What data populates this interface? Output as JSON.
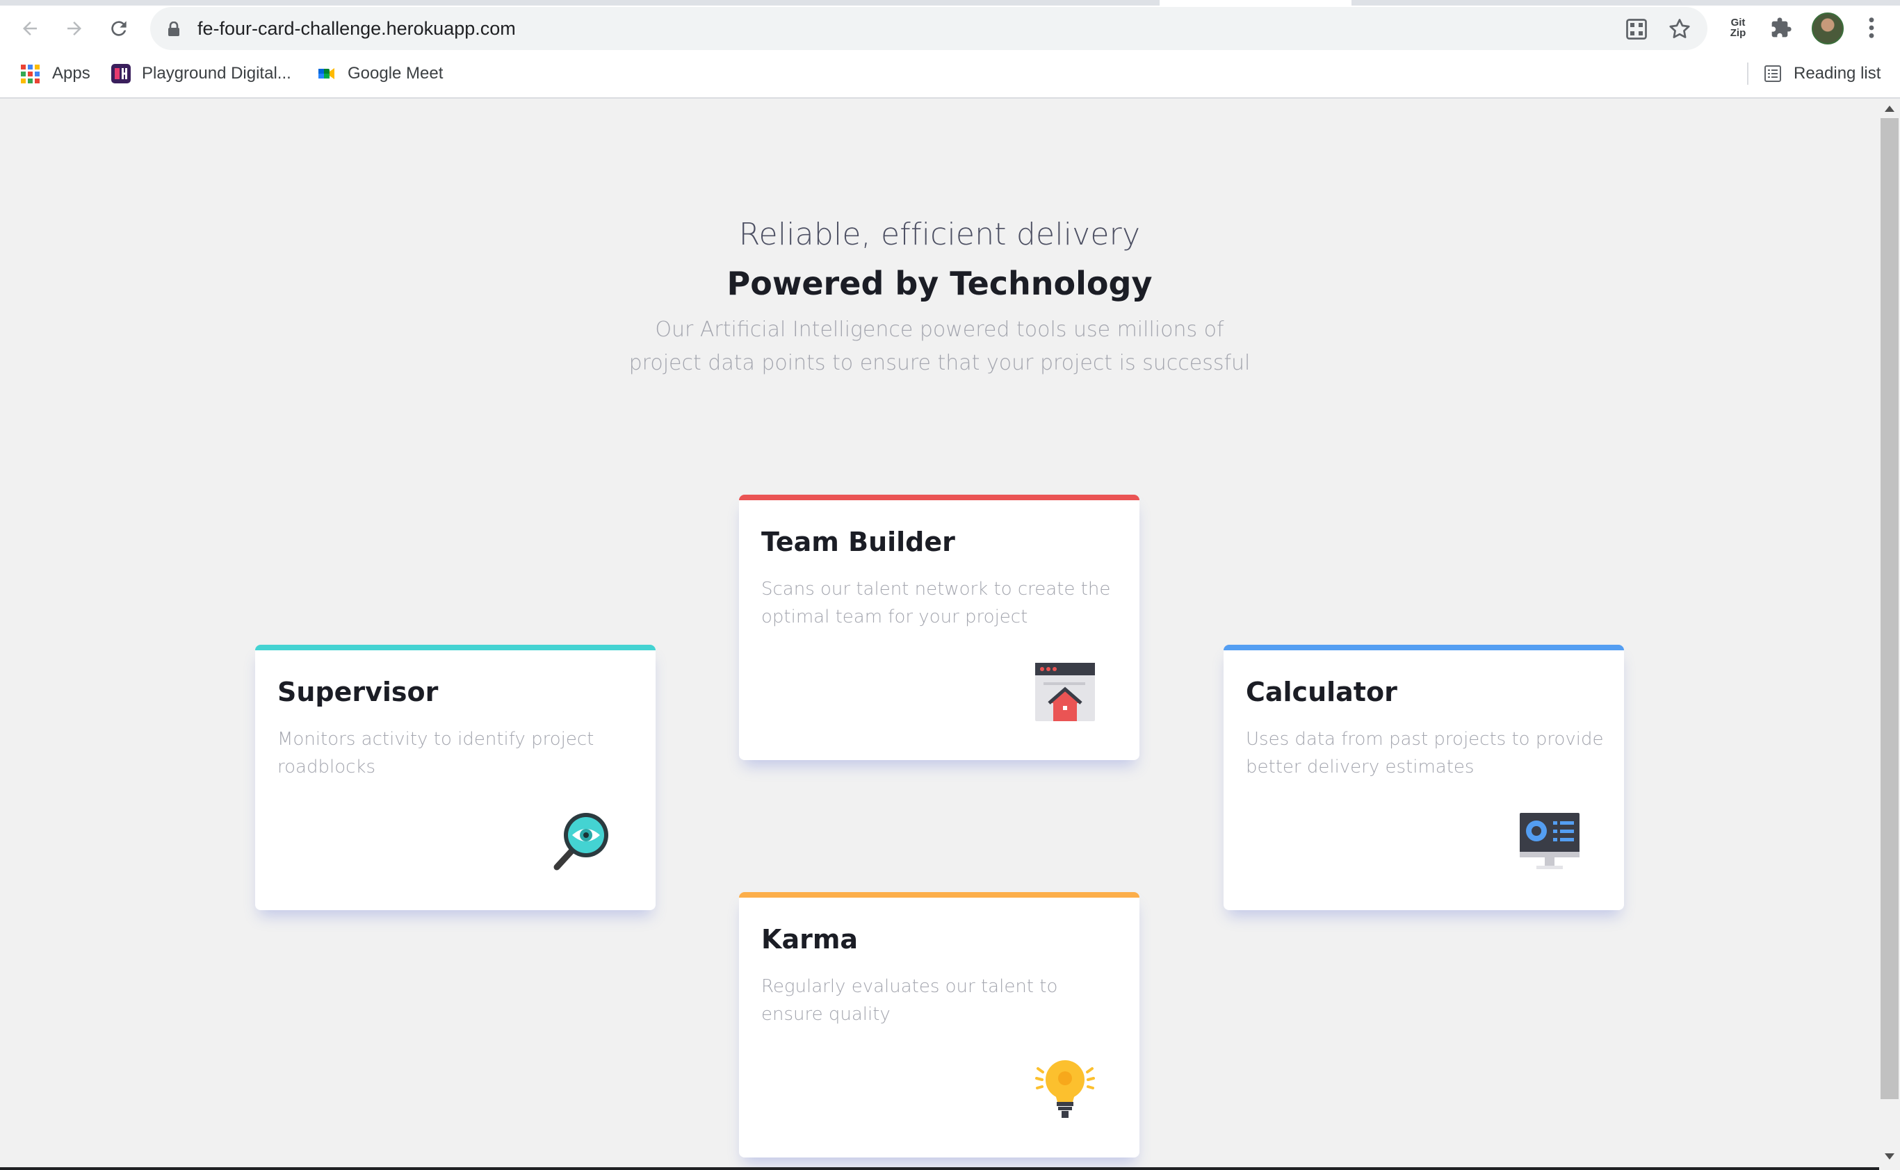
{
  "browser": {
    "url": "fe-four-card-challenge.herokuapp.com",
    "bookmarks": [
      {
        "label": "Apps",
        "icon": "apps-grid-icon"
      },
      {
        "label": "Playground Digital...",
        "icon": "playground-digital-icon"
      },
      {
        "label": "Google Meet",
        "icon": "google-meet-icon"
      }
    ],
    "reading_list": "Reading list",
    "gitzip": "Git Zip"
  },
  "hero": {
    "subtitle": "Reliable, efficient delivery",
    "title": "Powered by Technology",
    "description": "Our Artificial Intelligence powered tools use millions of project data points to ensure that your project is successful"
  },
  "cards": {
    "supervisor": {
      "title": "Supervisor",
      "text": "Monitors activity to identify project roadblocks",
      "accent": "#44d3d2",
      "icon": "magnifier-eye-icon"
    },
    "team_builder": {
      "title": "Team Builder",
      "text": "Scans our talent network to create the optimal team for your project",
      "accent": "#ea5454",
      "icon": "team-builder-icon"
    },
    "karma": {
      "title": "Karma",
      "text": "Regularly evaluates our talent to ensure quality",
      "accent": "#fcae4a",
      "icon": "lightbulb-icon"
    },
    "calculator": {
      "title": "Calculator",
      "text": "Uses data from past projects to provide better delivery estimates",
      "accent": "#549ef2",
      "icon": "calculator-monitor-icon"
    }
  }
}
